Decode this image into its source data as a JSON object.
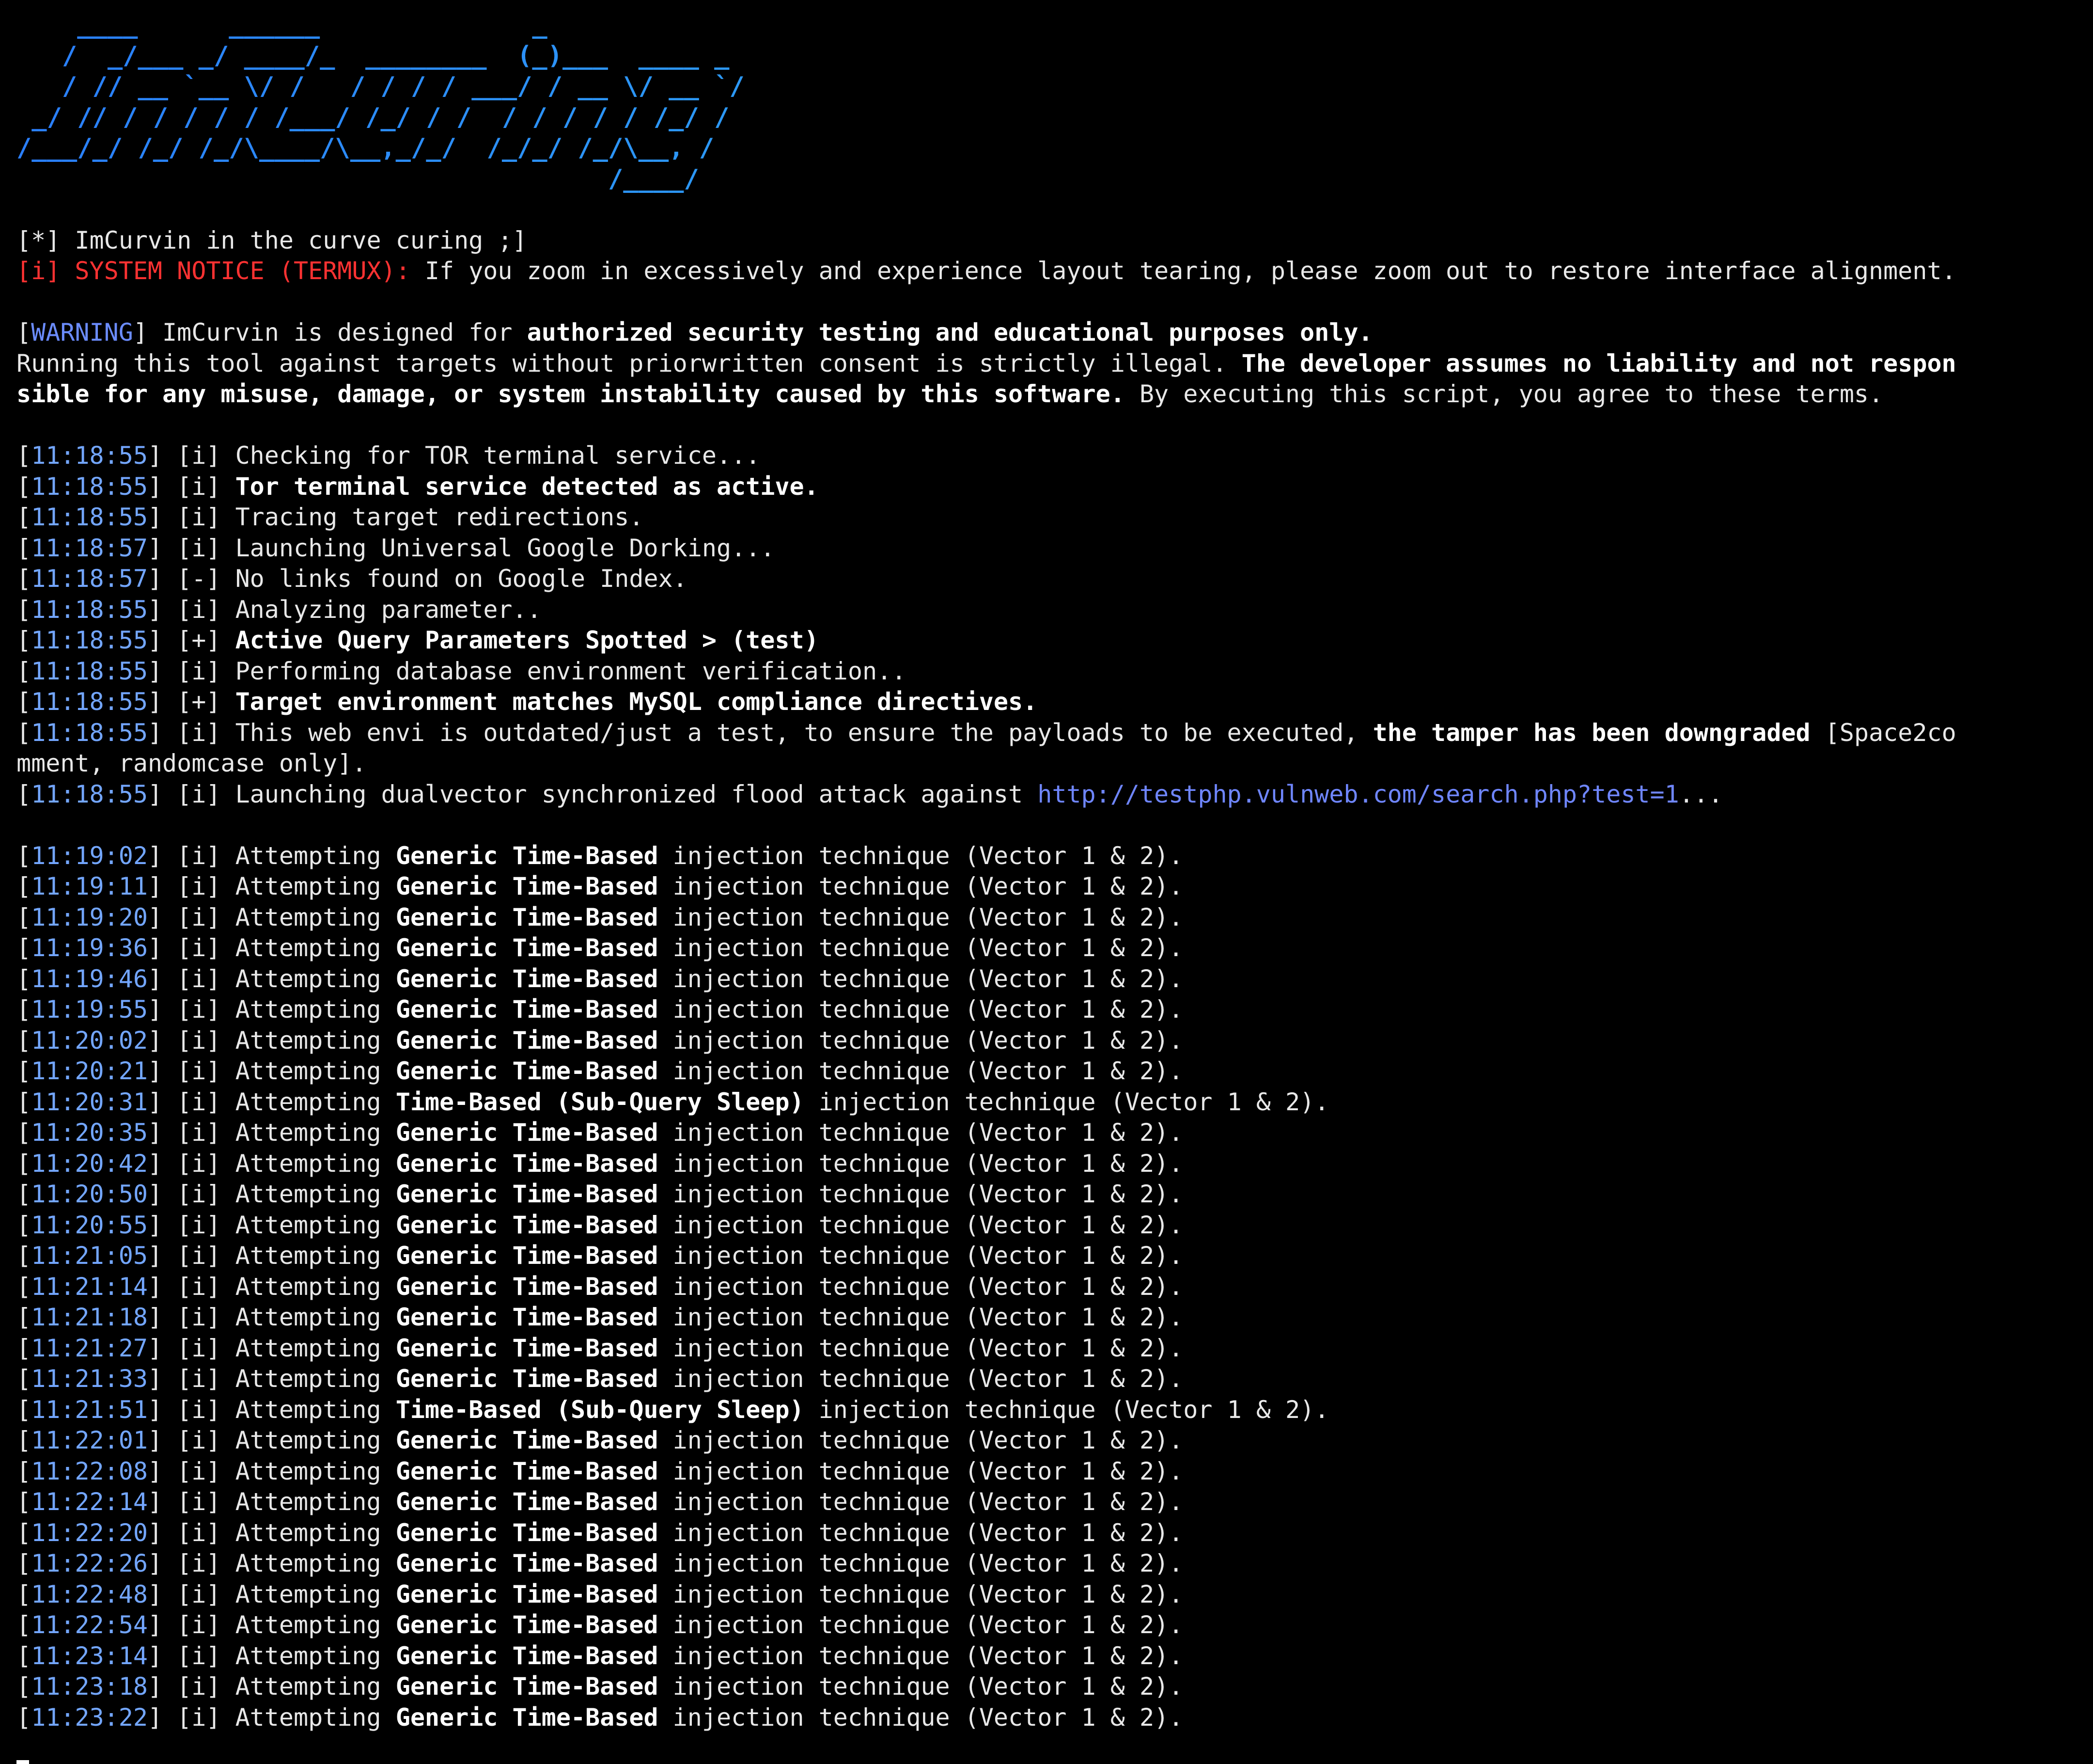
{
  "theme": {
    "background": "#000000",
    "text": "#e8e8e8",
    "timestamp": "#73a6ff",
    "notice_red": "#ff3232",
    "url": "#6f86ff",
    "banner_gradient": [
      "#2a7fff",
      "#36d7ff"
    ]
  },
  "banner": {
    "art": "    ____      ______              _\n   /  _/___ _/ ____/_  ________  (_)___  ____ _\n   / // __ `__ \\/ /   / / / / ___/ / __ \\/ __ `/\n _/ // / / / / / /___/ /_/ / /  / / / / / /_/ /\n/___/_/ /_/ /_/\\____/\\__,_/_/  /_/_/ /_/\\__, /\n                                       /____/"
  },
  "intro": {
    "tagline": "[*] ImCurvin in the curve curing ;]",
    "notice_label": "[i] SYSTEM NOTICE (TERMUX):",
    "notice_text": " If you zoom in excessively and experience layout tearing, please zoom out to restore interface alignment."
  },
  "warning": {
    "open": "[",
    "tag": "WARNING",
    "close": "]",
    "text1": " ImCurvin is designed for ",
    "bold1": "authorized security testing and educational purposes only.",
    "text2": "Running this tool against targets without priorwritten consent is strictly illegal. ",
    "bold2a": "The developer assumes no liability and not respon",
    "bold2b": "sible for any misuse, damage, or system instability caused by this software.",
    "text3": " By executing this script, you agree to these terms."
  },
  "log": [
    {
      "time": "11:18:55",
      "marker": "[i]",
      "text": "Checking for TOR terminal service...",
      "bold": false
    },
    {
      "time": "11:18:55",
      "marker": "[i]",
      "text": "Tor terminal service detected as active.",
      "bold": true
    },
    {
      "time": "11:18:55",
      "marker": "[i]",
      "text": "Tracing target redirections.",
      "bold": false
    },
    {
      "time": "11:18:57",
      "marker": "[i]",
      "text": "Launching Universal Google Dorking...",
      "bold": false
    },
    {
      "time": "11:18:57",
      "marker": "[-]",
      "text": "No links found on Google Index.",
      "bold": false
    },
    {
      "time": "11:18:55",
      "marker": "[i]",
      "text": "Analyzing parameter..",
      "bold": false
    },
    {
      "time": "11:18:55",
      "marker": "[+]",
      "text": "Active Query Parameters Spotted > (test)",
      "bold": true
    },
    {
      "time": "11:18:55",
      "marker": "[i]",
      "text": "Performing database environment verification..",
      "bold": false
    },
    {
      "time": "11:18:55",
      "marker": "[+]",
      "text": "Target environment matches MySQL compliance directives.",
      "bold": true
    }
  ],
  "tamper": {
    "time": "11:18:55",
    "marker": "[i]",
    "text": "This web envi is outdated/just a test, to ensure the payloads to be executed, ",
    "bold": "the tamper has been downgraded",
    "tail": " [Space2co",
    "wrap": "mment, randomcase only]."
  },
  "launch": {
    "time": "11:18:55",
    "marker": "[i]",
    "text": "Launching dualvector synchronized flood attack against ",
    "url": "http://testphp.vulnweb.com/search.php?test=1",
    "suffix": "..."
  },
  "attempt": {
    "marker": "[i]",
    "prefix": "Attempting ",
    "suffix": " injection technique (Vector 1 & 2)."
  },
  "attempts": [
    {
      "time": "11:19:02",
      "technique": "Generic Time-Based"
    },
    {
      "time": "11:19:11",
      "technique": "Generic Time-Based"
    },
    {
      "time": "11:19:20",
      "technique": "Generic Time-Based"
    },
    {
      "time": "11:19:36",
      "technique": "Generic Time-Based"
    },
    {
      "time": "11:19:46",
      "technique": "Generic Time-Based"
    },
    {
      "time": "11:19:55",
      "technique": "Generic Time-Based"
    },
    {
      "time": "11:20:02",
      "technique": "Generic Time-Based"
    },
    {
      "time": "11:20:21",
      "technique": "Generic Time-Based"
    },
    {
      "time": "11:20:31",
      "technique": "Time-Based (Sub-Query Sleep)"
    },
    {
      "time": "11:20:35",
      "technique": "Generic Time-Based"
    },
    {
      "time": "11:20:42",
      "technique": "Generic Time-Based"
    },
    {
      "time": "11:20:50",
      "technique": "Generic Time-Based"
    },
    {
      "time": "11:20:55",
      "technique": "Generic Time-Based"
    },
    {
      "time": "11:21:05",
      "technique": "Generic Time-Based"
    },
    {
      "time": "11:21:14",
      "technique": "Generic Time-Based"
    },
    {
      "time": "11:21:18",
      "technique": "Generic Time-Based"
    },
    {
      "time": "11:21:27",
      "technique": "Generic Time-Based"
    },
    {
      "time": "11:21:33",
      "technique": "Generic Time-Based"
    },
    {
      "time": "11:21:51",
      "technique": "Time-Based (Sub-Query Sleep)"
    },
    {
      "time": "11:22:01",
      "technique": "Generic Time-Based"
    },
    {
      "time": "11:22:08",
      "technique": "Generic Time-Based"
    },
    {
      "time": "11:22:14",
      "technique": "Generic Time-Based"
    },
    {
      "time": "11:22:20",
      "technique": "Generic Time-Based"
    },
    {
      "time": "11:22:26",
      "technique": "Generic Time-Based"
    },
    {
      "time": "11:22:48",
      "technique": "Generic Time-Based"
    },
    {
      "time": "11:22:54",
      "technique": "Generic Time-Based"
    },
    {
      "time": "11:23:14",
      "technique": "Generic Time-Based"
    },
    {
      "time": "11:23:18",
      "technique": "Generic Time-Based"
    },
    {
      "time": "11:23:22",
      "technique": "Generic Time-Based"
    }
  ]
}
